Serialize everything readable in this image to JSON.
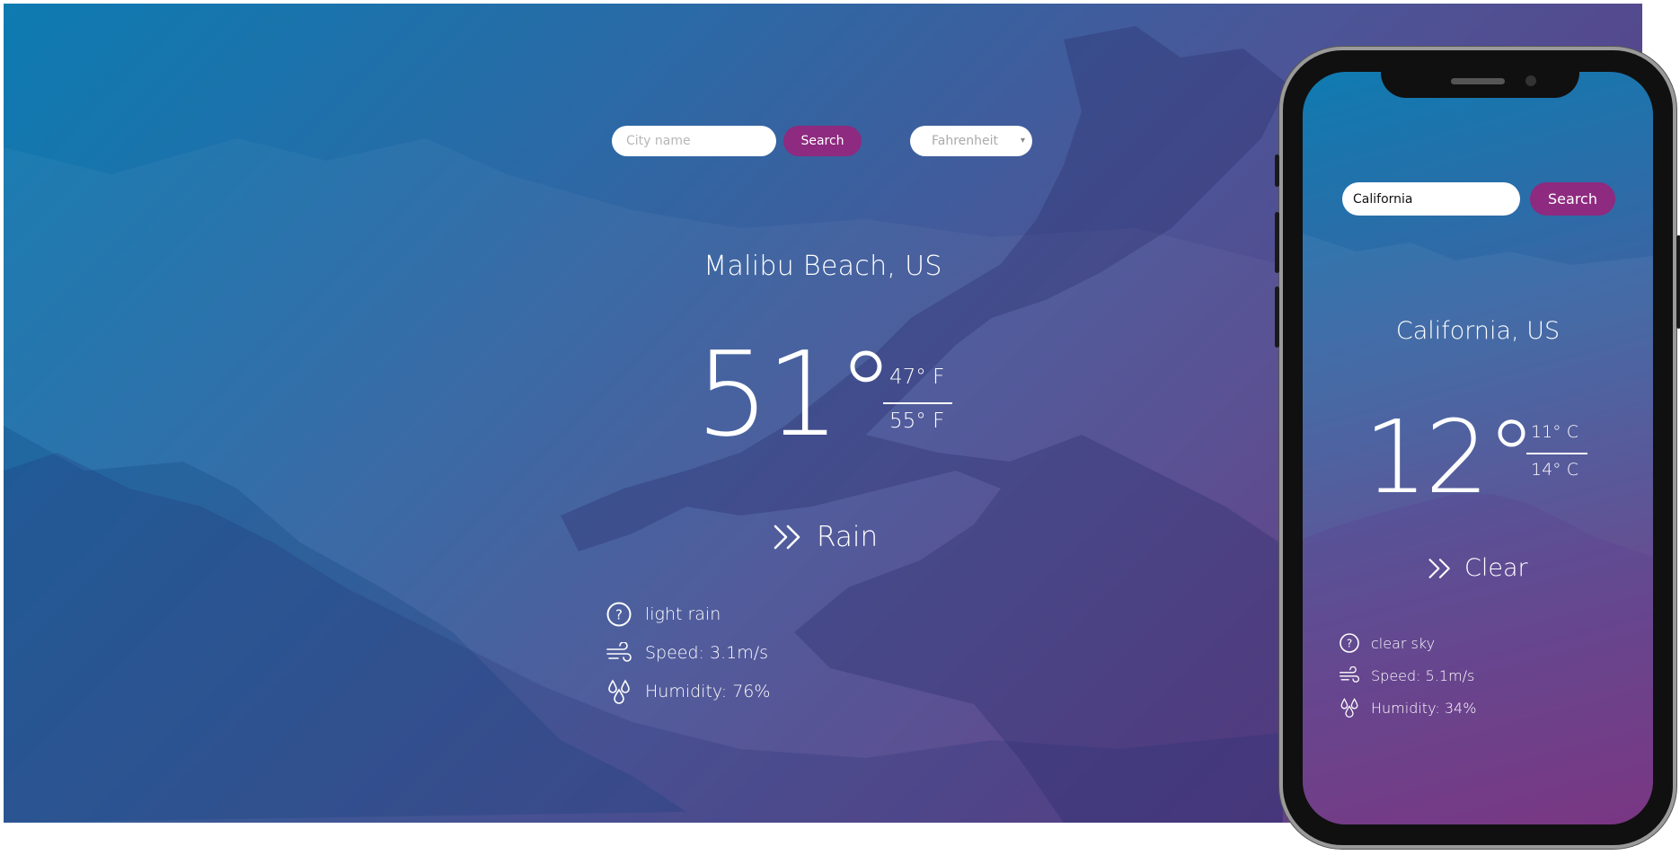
{
  "desktop": {
    "search": {
      "placeholder": "City name",
      "button_label": "Search"
    },
    "unit_select": {
      "selected": "Fahrenheit"
    },
    "location": "Malibu Beach, US",
    "temperature": {
      "current": "51°",
      "min": "47° F",
      "max": "55° F"
    },
    "condition": "Rain",
    "details": {
      "description": "light rain",
      "wind": "Speed: 3.1m/s",
      "humidity": "Humidity: 76%"
    }
  },
  "mobile": {
    "search": {
      "value": "California",
      "button_label": "Search"
    },
    "location": "California, US",
    "temperature": {
      "current": "12°",
      "min": "11° C",
      "max": "14° C"
    },
    "condition": "Clear",
    "details": {
      "description": "clear sky",
      "wind": "Speed: 5.1m/s",
      "humidity": "Humidity: 34%"
    }
  },
  "colors": {
    "accent_button": "#8e2a7f",
    "gradient_start": "#0d7bb1",
    "gradient_end": "#6b2d7a"
  },
  "icons": {
    "condition": "double-chevron-right-icon",
    "description": "question-circle-icon",
    "wind": "wind-icon",
    "humidity": "droplets-icon"
  }
}
